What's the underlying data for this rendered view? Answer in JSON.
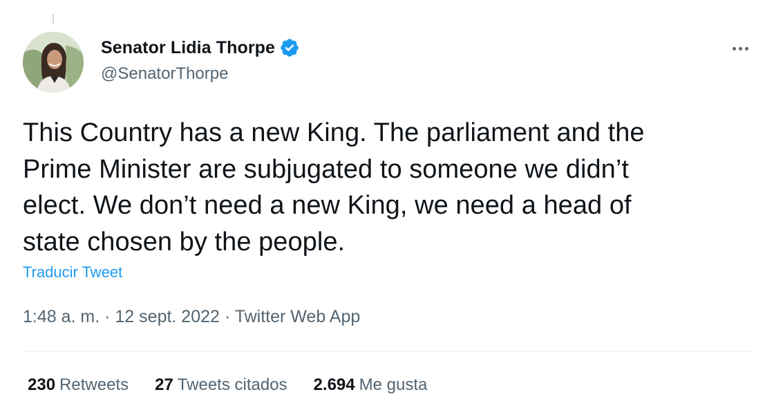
{
  "author": {
    "display_name": "Senator Lidia Thorpe",
    "handle": "@SenatorThorpe",
    "verified_badge": "verified-badge-icon"
  },
  "tweet": {
    "text": "This Country has a new King. The parliament and the\nPrime Minister are subjugated to someone we didn’t\nelect. We don’t need a new King, we need a head of\nstate chosen by the people.",
    "translate_label": "Traducir Tweet"
  },
  "meta": {
    "time": "1:48 a. m.",
    "separator": "·",
    "date": "12 sept. 2022",
    "source": "Twitter Web App"
  },
  "stats": [
    {
      "count": "230",
      "label": "Retweets"
    },
    {
      "count": "27",
      "label": "Tweets citados"
    },
    {
      "count": "2.694",
      "label": "Me gusta"
    }
  ],
  "colors": {
    "accent": "#1d9bf0",
    "text_primary": "#0f1419",
    "text_secondary": "#536471",
    "divider": "#eff3f4"
  }
}
